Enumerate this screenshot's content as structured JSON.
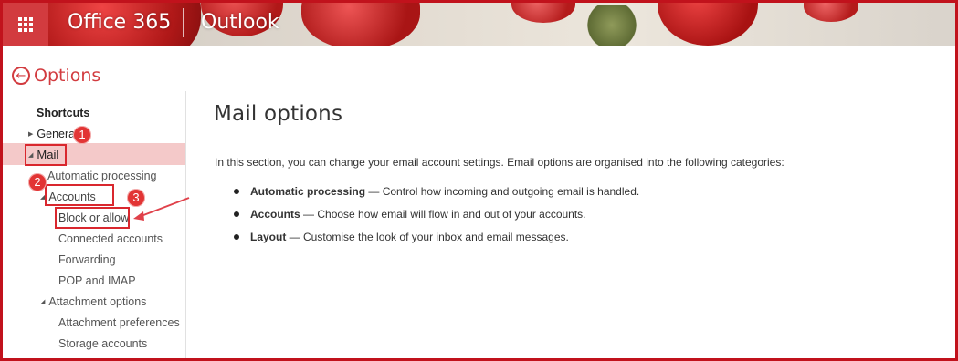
{
  "header": {
    "app_name": "Office 365",
    "module_name": "Outlook",
    "icons": {
      "app_launcher": "waffle-icon"
    },
    "colors": {
      "brand": "#d23b3f"
    }
  },
  "options": {
    "title": "Options",
    "back_icon": "back-arrow-circle-icon"
  },
  "sidebar": {
    "shortcuts": "Shortcuts",
    "general": "General",
    "mail": "Mail",
    "automatic_processing": "Automatic processing",
    "accounts": "Accounts",
    "block_or_allow": "Block or allow",
    "connected_accounts": "Connected accounts",
    "forwarding": "Forwarding",
    "pop_and_imap": "POP and IMAP",
    "attachment_options": "Attachment options",
    "attachment_preferences": "Attachment preferences",
    "storage_accounts": "Storage accounts",
    "selected_color": "#f4c9c9"
  },
  "annotations": {
    "badge_1": "1",
    "badge_2": "2",
    "badge_3": "3",
    "highlight_color": "#d9272e"
  },
  "main": {
    "title": "Mail options",
    "intro": "In this section, you can change your email account settings. Email options are organised into the following categories:",
    "items": [
      {
        "term": "Automatic processing",
        "desc": " — Control how incoming and outgoing email is handled."
      },
      {
        "term": "Accounts",
        "desc": " — Choose how email will flow in and out of your accounts."
      },
      {
        "term": "Layout",
        "desc": " — Customise the look of your inbox and email messages."
      }
    ]
  }
}
